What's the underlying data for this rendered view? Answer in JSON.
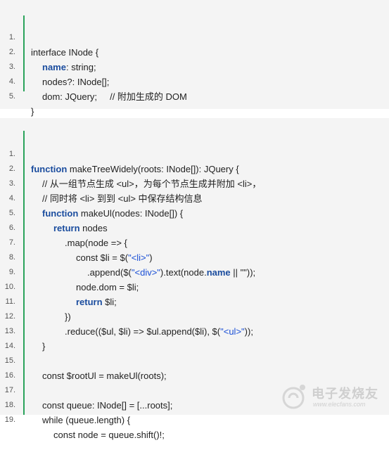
{
  "block1": {
    "lines": [
      {
        "num": "1.",
        "text": "interface INode {"
      },
      {
        "num": "2.",
        "prop": "name",
        "rest": ": string;"
      },
      {
        "num": "3.",
        "text": "nodes?: INode[];"
      },
      {
        "num": "4.",
        "text": "dom: JQuery;     // 附加生成的 DOM"
      },
      {
        "num": "5.",
        "text": "}"
      }
    ]
  },
  "block2": {
    "lines": [
      {
        "num": "1.",
        "kw": "function",
        "rest": " makeTreeWidely(roots: INode[]): JQuery {"
      },
      {
        "num": "2.",
        "text": "// 从一组节点生成 <ul>，为每个节点生成并附加 <li>，"
      },
      {
        "num": "3.",
        "text": "// 同时将 <li> 到到 <ul> 中保存结构信息"
      },
      {
        "num": "4.",
        "kw": "function",
        "rest": " makeUl(nodes: INode[]) {"
      },
      {
        "num": "5.",
        "kw": "return",
        "rest": " nodes"
      },
      {
        "num": "6.",
        "text": ".map(node => {"
      },
      {
        "num": "7.",
        "pre": "const $li = $(",
        "str": "\"<li>\"",
        "post": ")"
      },
      {
        "num": "8.",
        "pre": ".append($(",
        "str": "\"<div>\"",
        "mid": ").text(node.",
        "prop": "name",
        "post": " || \"\"));"
      },
      {
        "num": "9.",
        "text": "node.dom = $li;"
      },
      {
        "num": "10.",
        "kw": "return",
        "rest": " $li;"
      },
      {
        "num": "11.",
        "text": "})"
      },
      {
        "num": "12.",
        "pre": ".reduce(($ul, $li) => $ul.append($li), $(",
        "str": "\"<ul>\"",
        "post": "));"
      },
      {
        "num": "13.",
        "text": "}"
      },
      {
        "num": "14.",
        "text": ""
      },
      {
        "num": "15.",
        "text": "const $rootUl = makeUl(roots);"
      },
      {
        "num": "16.",
        "text": ""
      },
      {
        "num": "17.",
        "text": "const queue: INode[] = [...roots];"
      },
      {
        "num": "18.",
        "text": "while (queue.length) {"
      },
      {
        "num": "19.",
        "text": "const node = queue.shift()!;"
      }
    ]
  },
  "watermark": {
    "title": "电子发烧友",
    "url": "www.elecfans.com"
  },
  "colors": {
    "accent_bar": "#2aa35b",
    "keyword": "#1a4c9e",
    "string": "#1a4fd6",
    "background": "#f4f4f4"
  }
}
